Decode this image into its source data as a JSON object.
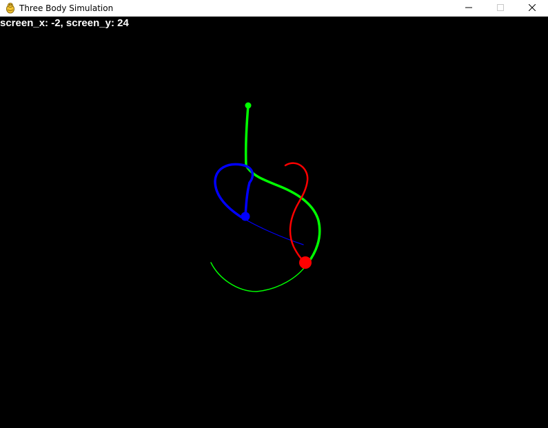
{
  "window": {
    "title": "Three Body Simulation",
    "app_icon": "pygame-snake-icon",
    "controls": {
      "minimize_icon": "minimize-icon",
      "maximize_icon": "maximize-icon",
      "close_icon": "close-icon"
    }
  },
  "readout": {
    "text": "screen_x: -2, screen_y: 24"
  },
  "simulation": {
    "background": "#000000",
    "bodies": [
      {
        "name": "green",
        "color": "#00ff00"
      },
      {
        "name": "blue",
        "color": "#0000ff"
      },
      {
        "name": "red",
        "color": "#ff0000"
      }
    ]
  }
}
